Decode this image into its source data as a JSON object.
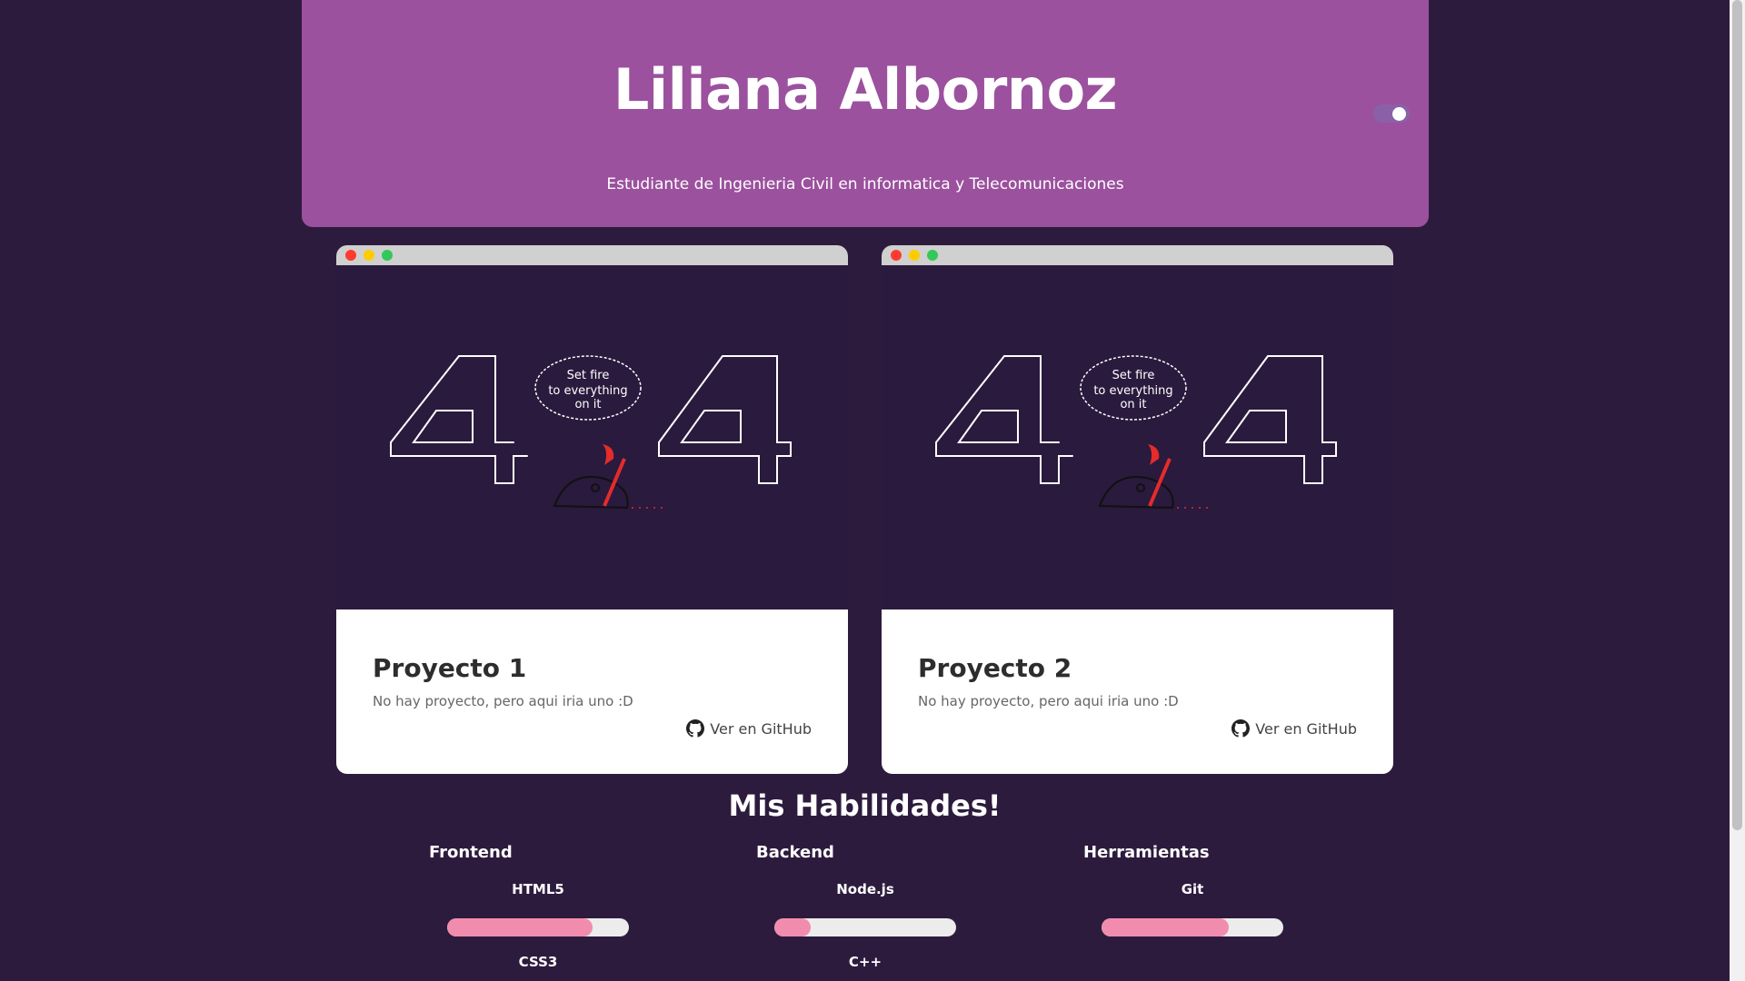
{
  "header": {
    "title": "Liliana Albornoz",
    "subtitle": "Estudiante de Ingenieria Civil en informatica y Telecomunicaciones",
    "theme_toggle_on": true
  },
  "projects": [
    {
      "title": "Proyecto 1",
      "description": "No hay proyecto, pero aqui iria uno :D",
      "link_label": "Ver en GitHub",
      "image_text": "404"
    },
    {
      "title": "Proyecto 2",
      "description": "No hay proyecto, pero aqui iria uno :D",
      "link_label": "Ver en GitHub",
      "image_text": "404"
    }
  ],
  "skills": {
    "title": "Mis Habilidades!",
    "columns": [
      {
        "heading": "Frontend",
        "items": [
          {
            "name": "HTML5",
            "level": 0.8
          },
          {
            "name": "CSS3"
          }
        ]
      },
      {
        "heading": "Backend",
        "items": [
          {
            "name": "Node.js",
            "level": 0.2
          },
          {
            "name": "C++"
          }
        ]
      },
      {
        "heading": "Herramientas",
        "items": [
          {
            "name": "Git",
            "level": 0.7
          }
        ]
      }
    ]
  },
  "colors": {
    "background": "#2d1b3e",
    "header": "#9b519e",
    "skill_fill": "#f28cae",
    "skill_track": "#ececec"
  },
  "icons": [
    "github-icon",
    "window-dots-icon"
  ]
}
